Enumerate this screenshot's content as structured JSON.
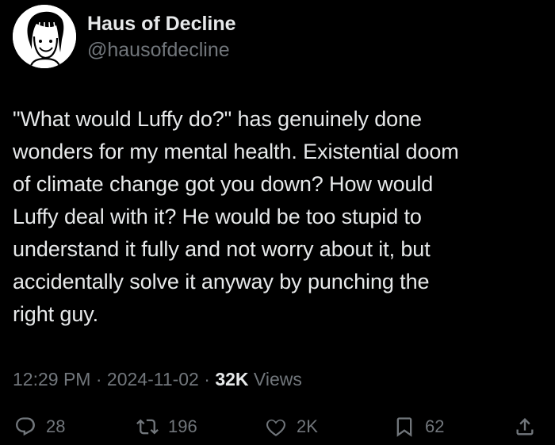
{
  "author": {
    "display_name": "Haus of Decline",
    "handle": "@hausofdecline",
    "avatar_icon": "cartoon-face-avatar"
  },
  "tweet": {
    "text": "\"What would Luffy do?\" has genuinely done\nwonders for my mental health. Existential doom\nof climate change got you down? How would\nLuffy deal with it? He would be too stupid to\nunderstand it fully and not worry about it, but\naccidentally solve it anyway by punching the\nright guy."
  },
  "meta": {
    "time": "12:29 PM",
    "separator": "·",
    "date": "2024-11-02",
    "views_count": "32K",
    "views_label": "Views"
  },
  "actions": {
    "reply": {
      "icon": "reply-icon",
      "count": "28"
    },
    "retweet": {
      "icon": "retweet-icon",
      "count": "196"
    },
    "like": {
      "icon": "heart-icon",
      "count": "2K"
    },
    "bookmark": {
      "icon": "bookmark-icon",
      "count": "62"
    },
    "share": {
      "icon": "share-icon"
    }
  },
  "colors": {
    "background": "#000000",
    "primary_text": "#e7e9ea",
    "secondary_text": "#71767b"
  }
}
